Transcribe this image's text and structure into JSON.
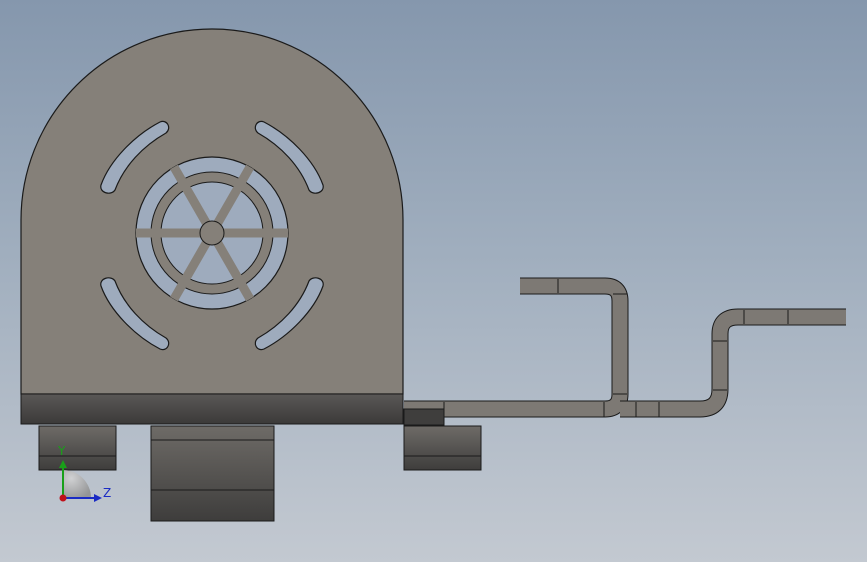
{
  "viewport": {
    "background_top": "#8597ad",
    "background_bottom": "#c3c9d1"
  },
  "model": {
    "body_color": "#858079",
    "edge_color": "#1a1a1a",
    "cutout_color": "#9eabbd"
  },
  "triad": {
    "y_label": "Y",
    "z_label": "Z",
    "y_color": "#19a019",
    "z_color": "#1a2bc4",
    "origin_color": "#c0101a"
  }
}
